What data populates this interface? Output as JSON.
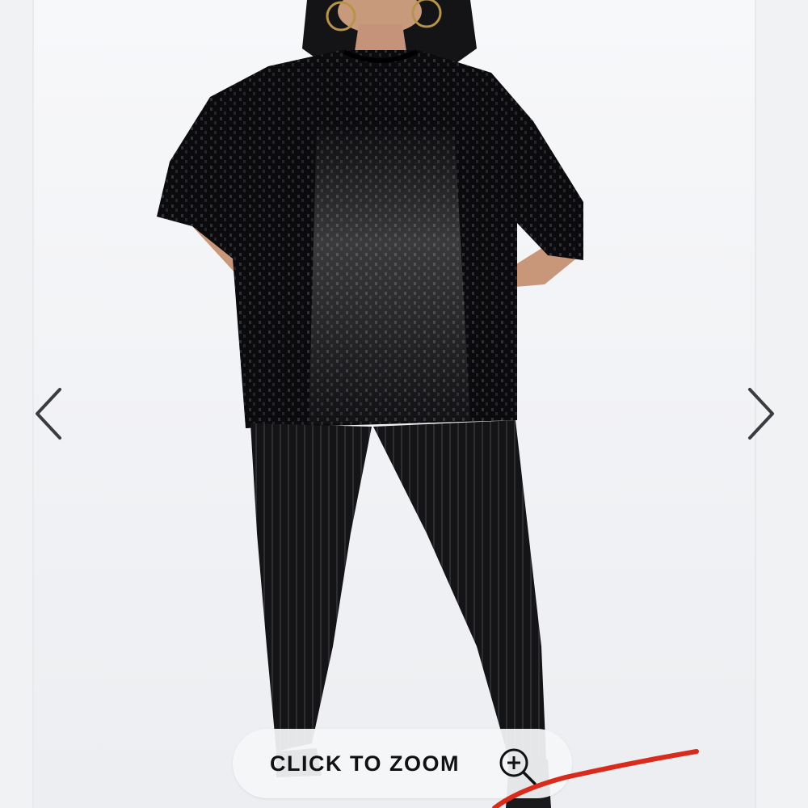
{
  "gallery": {
    "zoom_label": "CLICK TO ZOOM",
    "icons": {
      "prev": "chevron-left-icon",
      "next": "chevron-right-icon",
      "zoom": "zoom-in-icon"
    },
    "colors": {
      "arrow": "#3a3c40",
      "annotation": "#d92a1c",
      "garment": "#0d0d0f"
    }
  }
}
